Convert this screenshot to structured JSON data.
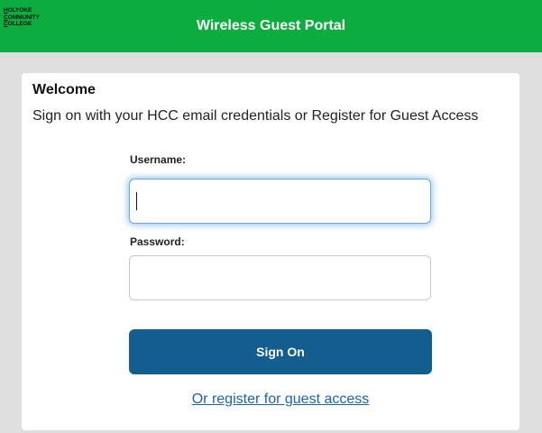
{
  "header": {
    "logo_lines": [
      "HOLYOKE",
      "COMMUNITY",
      "COLLEGE"
    ],
    "title": "Wireless Guest Portal",
    "background_color": "#0cad3e"
  },
  "login": {
    "welcome": "Welcome",
    "instructions": "Sign on with your HCC email credentials or Register for Guest Access",
    "username_label": "Username:",
    "username_value": "",
    "password_label": "Password:",
    "password_value": "",
    "signon_label": "Sign On",
    "signon_color": "#135e8e",
    "register_link": "Or register for guest access",
    "link_color": "#1a62b5"
  }
}
